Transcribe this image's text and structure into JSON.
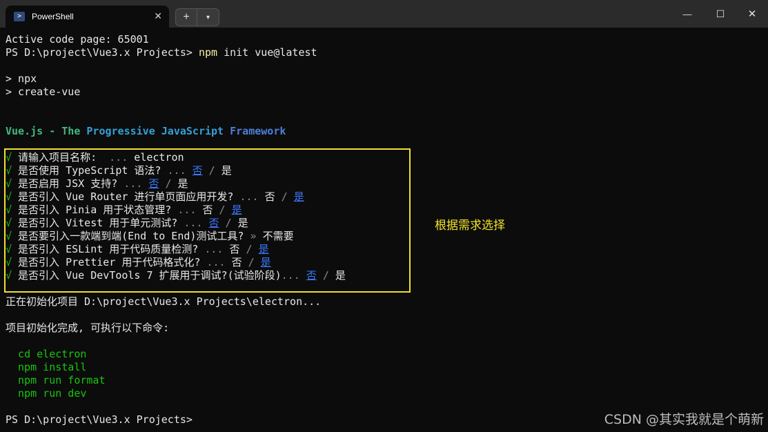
{
  "window": {
    "tab_title": "PowerShell",
    "tab_icon": "powershell-icon",
    "close_tab": "✕",
    "new_tab": "+",
    "dropdown": "⌄",
    "minimize": "—",
    "maximize": "☐",
    "close": "✕"
  },
  "terminal": {
    "l1": "Active code page: 65001",
    "prompt1": "PS D:\\project\\Vue3.x Projects> ",
    "cmd_npm": "npm",
    "cmd_rest": " init vue@latest",
    "npx": "> npx",
    "create_vue": "> create-vue",
    "banner": {
      "vue": "Vue.js",
      "dash": " - ",
      "the": "The",
      "progressive": "Progressive",
      "javascript": "JavaScript",
      "framework": "Framework"
    },
    "questions": [
      {
        "check": "√",
        "q": " 请输入项目名称: ",
        "dots": " ... ",
        "answer": "electron"
      },
      {
        "check": "√",
        "q": " 是否使用 TypeScript 语法?",
        "dots": " ... ",
        "no": "否",
        "sep": " / ",
        "yes": "是"
      },
      {
        "check": "√",
        "q": " 是否启用 JSX 支持?",
        "dots": " ... ",
        "no": "否",
        "sep": " / ",
        "yes": "是"
      },
      {
        "check": "√",
        "q": " 是否引入 Vue Router 进行单页面应用开发?",
        "dots": " ... ",
        "no": "否",
        "sep": " / ",
        "yes": "是"
      },
      {
        "check": "√",
        "q": " 是否引入 Pinia 用于状态管理?",
        "dots": " ... ",
        "no": "否",
        "sep": " / ",
        "yes": "是"
      },
      {
        "check": "√",
        "q": " 是否引入 Vitest 用于单元测试?",
        "dots": " ... ",
        "no": "否",
        "sep": " / ",
        "yes": "是"
      },
      {
        "check": "√",
        "q": " 是否要引入一款端到端(End to End)测试工具?",
        "dots": " » ",
        "answer": "不需要"
      },
      {
        "check": "√",
        "q": " 是否引入 ESLint 用于代码质量检测?",
        "dots": " ... ",
        "no": "否",
        "sep": " / ",
        "yes": "是"
      },
      {
        "check": "√",
        "q": " 是否引入 Prettier 用于代码格式化?",
        "dots": " ... ",
        "no": "否",
        "sep": " / ",
        "yes": "是"
      },
      {
        "check": "√",
        "q": " 是否引入 Vue DevTools 7 扩展用于调试?(试验阶段)",
        "dots": "... ",
        "no": "否",
        "sep": " / ",
        "yes": "是"
      }
    ],
    "init_line": "正在初始化项目 D:\\project\\Vue3.x Projects\\electron...",
    "done_line": "项目初始化完成, 可执行以下命令:",
    "cmds": [
      "  cd electron",
      "  npm install",
      "  npm run format",
      "  npm run dev"
    ],
    "prompt2": "PS D:\\project\\Vue3.x Projects>"
  },
  "annotation": "根据需求选择",
  "watermark": "CSDN @其实我就是个萌新",
  "colors": {
    "background": "#0c0c0c",
    "highlight_box": "#f2e12a",
    "selected_option": "#3b78ff",
    "command_green": "#16c60c"
  }
}
